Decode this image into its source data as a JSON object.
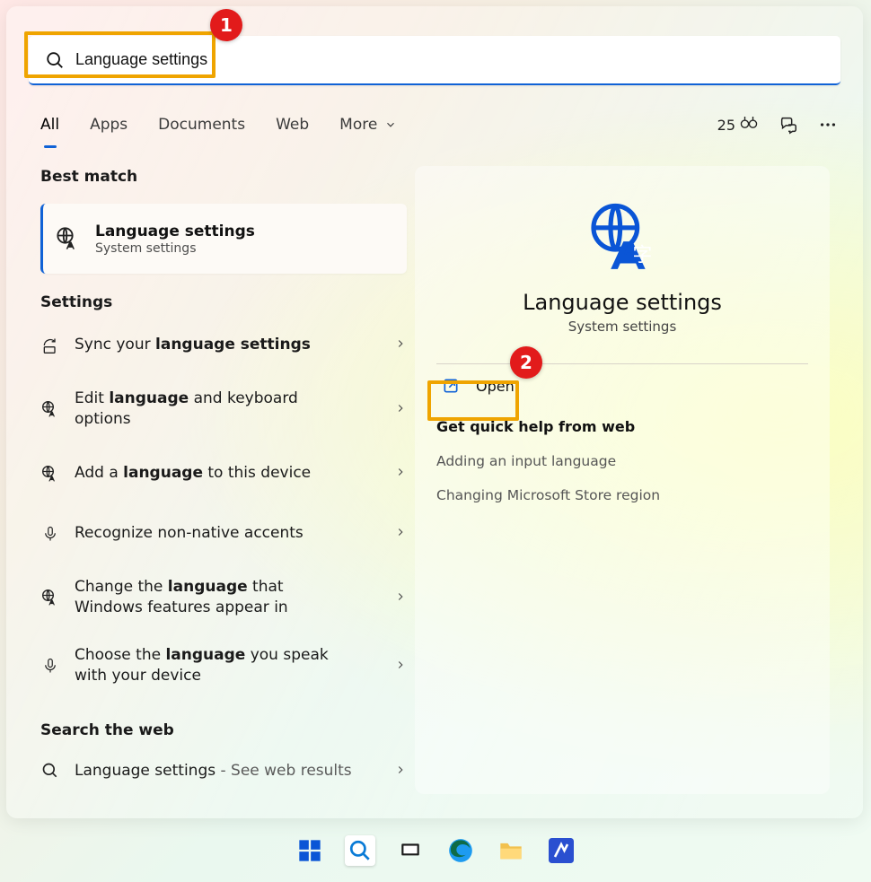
{
  "search": {
    "value": "Language settings"
  },
  "tabs": {
    "all": "All",
    "apps": "Apps",
    "documents": "Documents",
    "web": "Web",
    "more": "More"
  },
  "header": {
    "points": "25"
  },
  "left": {
    "best_match_label": "Best match",
    "best_match": {
      "title": "Language settings",
      "subtitle": "System settings"
    },
    "settings_label": "Settings",
    "items": [
      {
        "prefix": "Sync your ",
        "bold": "language settings",
        "suffix": "",
        "icon": "sync"
      },
      {
        "prefix": "Edit ",
        "bold": "language",
        "suffix": " and keyboard options",
        "icon": "lang"
      },
      {
        "prefix": "Add a ",
        "bold": "language",
        "suffix": " to this device",
        "icon": "lang"
      },
      {
        "prefix": "Recognize non-native accents",
        "bold": "",
        "suffix": "",
        "icon": "mic"
      },
      {
        "prefix": "Change the ",
        "bold": "language",
        "suffix": " that Windows features appear in",
        "icon": "lang"
      },
      {
        "prefix": "Choose the ",
        "bold": "language",
        "suffix": " you speak with your device",
        "icon": "mic"
      }
    ],
    "search_web_label": "Search the web",
    "web_result": {
      "text": "Language settings",
      "suffix": " - See web results"
    }
  },
  "detail": {
    "title": "Language settings",
    "subtitle": "System settings",
    "open_label": "Open",
    "help_header": "Get quick help from web",
    "help_links": [
      "Adding an input language",
      "Changing Microsoft Store region"
    ]
  },
  "annotations": {
    "b1": "1",
    "b2": "2"
  }
}
